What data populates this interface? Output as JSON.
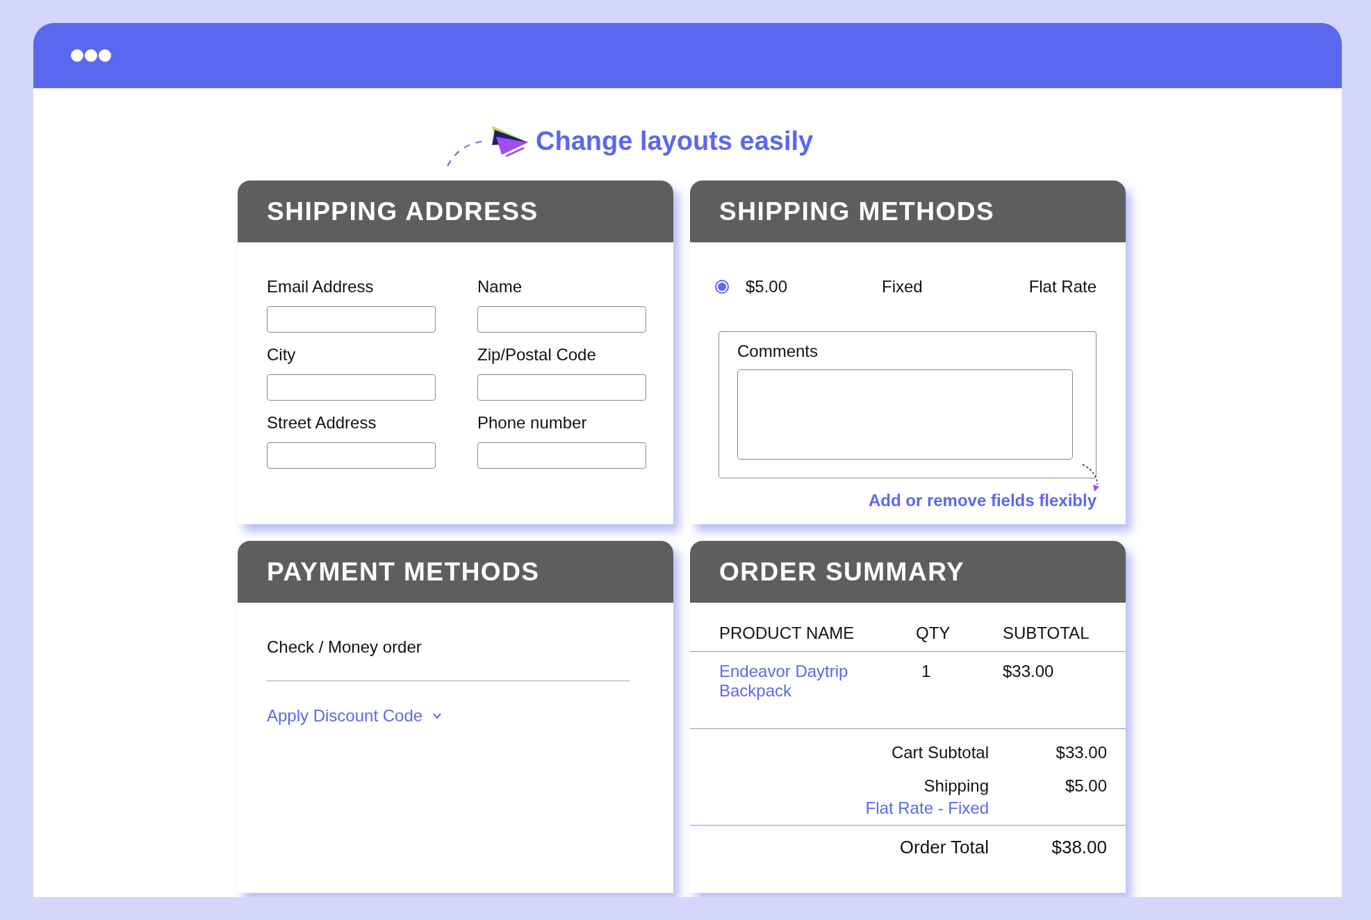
{
  "annotation_top": "Change layouts easily",
  "shipping_address": {
    "title": "SHIPPING ADDRESS",
    "fields": [
      {
        "label": "Email Address"
      },
      {
        "label": "Name"
      },
      {
        "label": "City"
      },
      {
        "label": "Zip/Postal Code"
      },
      {
        "label": "Street Address"
      },
      {
        "label": "Phone number"
      }
    ]
  },
  "shipping_methods": {
    "title": "SHIPPING METHODS",
    "options": [
      {
        "price": "$5.00",
        "method": "Fixed",
        "carrier": "Flat Rate",
        "selected": true
      }
    ],
    "comments": {
      "label": "Comments"
    },
    "annotation": "Add or remove fields flexibly"
  },
  "payment_methods": {
    "title": "PAYMENT METHODS",
    "method": "Check / Money order",
    "discount_link": "Apply Discount Code"
  },
  "order_summary": {
    "title": "ORDER SUMMARY",
    "columns": [
      "PRODUCT NAME",
      "QTY",
      "SUBTOTAL"
    ],
    "rows": [
      {
        "product": "Endeavor Daytrip Backpack",
        "qty": "1",
        "subtotal": "$33.00"
      }
    ],
    "totals": [
      {
        "label": "Cart Subtotal",
        "value": "$33.00"
      },
      {
        "label": "Shipping",
        "value": "$5.00",
        "note": "Flat Rate - Fixed"
      }
    ],
    "grand_total": {
      "label": "Order Total",
      "value": "$38.00"
    }
  }
}
